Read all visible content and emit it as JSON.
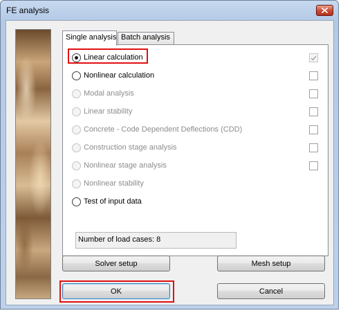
{
  "window": {
    "title": "FE analysis"
  },
  "tabs": [
    {
      "label": "Single analysis",
      "active": true
    },
    {
      "label": "Batch analysis",
      "active": false
    }
  ],
  "options": [
    {
      "label": "Linear calculation",
      "selected": true,
      "enabled": true,
      "has_checkbox": true,
      "checked": true,
      "checkbox_enabled": false
    },
    {
      "label": "Nonlinear calculation",
      "selected": false,
      "enabled": true,
      "has_checkbox": true,
      "checked": false,
      "checkbox_enabled": true
    },
    {
      "label": "Modal analysis",
      "selected": false,
      "enabled": false,
      "has_checkbox": true,
      "checked": false,
      "checkbox_enabled": true
    },
    {
      "label": "Linear stability",
      "selected": false,
      "enabled": false,
      "has_checkbox": true,
      "checked": false,
      "checkbox_enabled": true
    },
    {
      "label": "Concrete - Code Dependent Deflections (CDD)",
      "selected": false,
      "enabled": false,
      "has_checkbox": true,
      "checked": false,
      "checkbox_enabled": true
    },
    {
      "label": "Construction stage analysis",
      "selected": false,
      "enabled": false,
      "has_checkbox": true,
      "checked": false,
      "checkbox_enabled": true
    },
    {
      "label": "Nonlinear stage analysis",
      "selected": false,
      "enabled": false,
      "has_checkbox": true,
      "checked": false,
      "checkbox_enabled": true
    },
    {
      "label": "Nonlinear stability",
      "selected": false,
      "enabled": false,
      "has_checkbox": false
    },
    {
      "label": "Test of input data",
      "selected": false,
      "enabled": true,
      "has_checkbox": false
    }
  ],
  "load_cases": {
    "text": "Number of load cases: 8"
  },
  "buttons": {
    "solver_setup": "Solver setup",
    "mesh_setup": "Mesh setup",
    "ok": "OK",
    "cancel": "Cancel"
  },
  "colors": {
    "highlight": "#e01010",
    "title_gradient": "#b3c9e6",
    "close_button": "#c74a33"
  },
  "icons": {
    "close": "close-icon",
    "radio": "radio-icon",
    "check": "checkmark-icon"
  }
}
